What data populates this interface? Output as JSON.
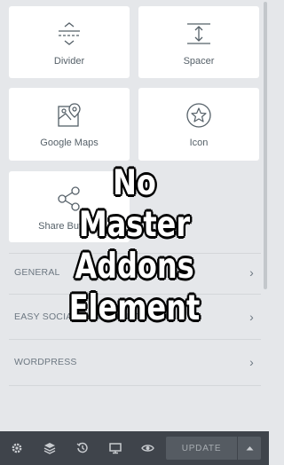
{
  "widgets": [
    {
      "label": "Divider",
      "icon": "divider-icon"
    },
    {
      "label": "Spacer",
      "icon": "spacer-icon"
    },
    {
      "label": "Google Maps",
      "icon": "map-icon"
    },
    {
      "label": "Icon",
      "icon": "star-icon"
    },
    {
      "label": "Share Buttons",
      "icon": "share-icon"
    }
  ],
  "categories": [
    {
      "label": "GENERAL"
    },
    {
      "label": "EASY SOCIAL SHARE BUTTONS"
    },
    {
      "label": "WORDPRESS"
    }
  ],
  "overlay": {
    "line1": "No",
    "line2": "Master Addons",
    "line3": "Element"
  },
  "footer": {
    "update_label": "UPDATE",
    "icons": [
      "gear-icon",
      "layers-icon",
      "history-icon",
      "desktop-icon",
      "eye-icon"
    ]
  },
  "colors": {
    "panel_bg": "#e5e7ea",
    "card_bg": "#ffffff",
    "footer_bg": "#3f444b",
    "button_bg": "#555b62"
  }
}
